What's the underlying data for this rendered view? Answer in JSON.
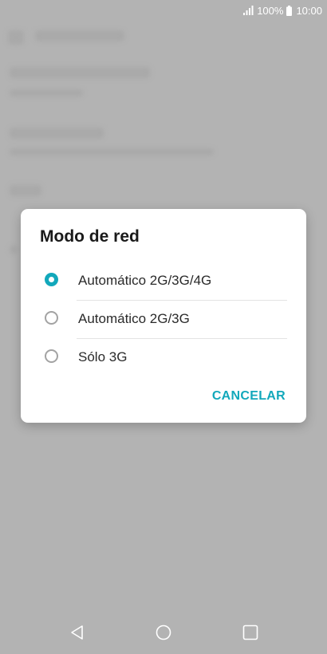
{
  "status_bar": {
    "battery_percent": "100%",
    "time": "10:00",
    "icons": [
      "signal-icon",
      "battery-icon"
    ]
  },
  "dialog": {
    "title": "Modo de red",
    "options": [
      {
        "label": "Automático 2G/3G/4G",
        "selected": true
      },
      {
        "label": "Automático 2G/3G",
        "selected": false
      },
      {
        "label": "Sólo 3G",
        "selected": false
      }
    ],
    "cancel_label": "CANCELAR",
    "accent_color": "#12a8bb"
  },
  "nav_bar": {
    "icons": [
      "back-icon",
      "home-icon",
      "recents-icon"
    ]
  }
}
